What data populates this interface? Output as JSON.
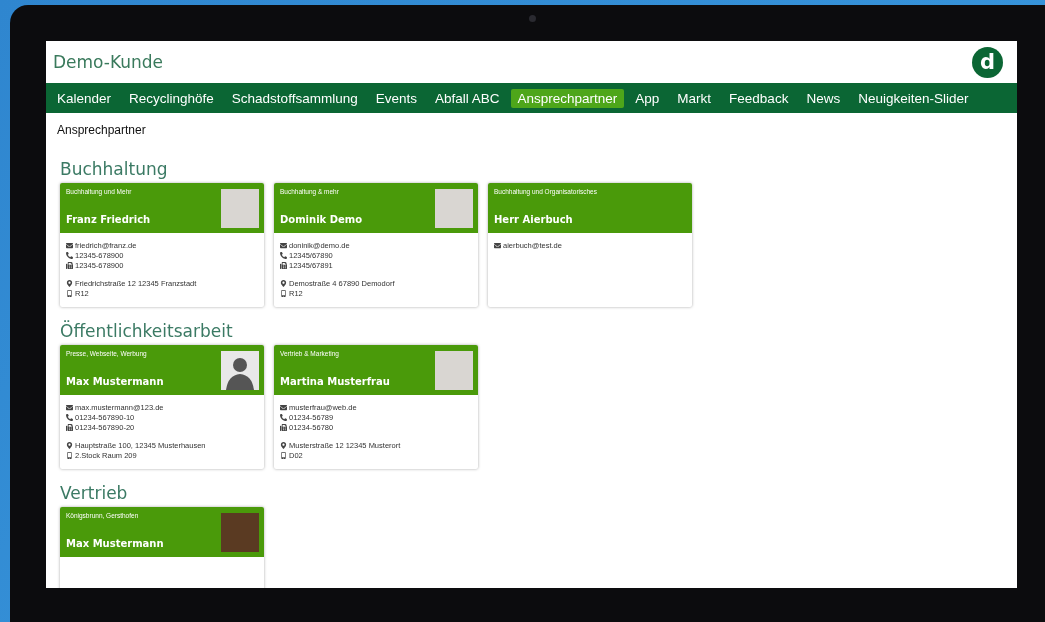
{
  "window": {
    "title": "Demo-Kunde",
    "logo": "d"
  },
  "nav": [
    {
      "label": "Kalender",
      "selected": false
    },
    {
      "label": "Recyclinghöfe",
      "selected": false
    },
    {
      "label": "Schadstoffsammlung",
      "selected": false
    },
    {
      "label": "Events",
      "selected": false
    },
    {
      "label": "Abfall ABC",
      "selected": false
    },
    {
      "label": "Ansprechpartner",
      "selected": true
    },
    {
      "label": "App",
      "selected": false
    },
    {
      "label": "Markt",
      "selected": false
    },
    {
      "label": "Feedback",
      "selected": false
    },
    {
      "label": "News",
      "selected": false
    },
    {
      "label": "Neuigkeiten-Slider",
      "selected": false
    }
  ],
  "page_title": "Ansprechpartner",
  "sections": [
    {
      "title": "Buchhaltung",
      "cards": [
        {
          "tagline": "Buchhaltung und Mehr",
          "name": "Franz Friedrich",
          "photo": {
            "kind": "portrait"
          },
          "contact": [
            {
              "kind": "email",
              "text": "friedrich@franz.de"
            },
            {
              "kind": "phone",
              "text": "12345-678900"
            },
            {
              "kind": "fax",
              "text": "12345-678900"
            }
          ],
          "location": [
            {
              "kind": "address",
              "text": "Friedrichstraße 12 12345 Franzstadt"
            },
            {
              "kind": "room",
              "text": "R12"
            }
          ]
        },
        {
          "tagline": "Buchhaltung & mehr",
          "name": "Dominik Demo",
          "photo": {
            "kind": "portrait"
          },
          "contact": [
            {
              "kind": "email",
              "text": "doninik@demo.de"
            },
            {
              "kind": "phone",
              "text": "12345/67890"
            },
            {
              "kind": "fax",
              "text": "12345/67891"
            }
          ],
          "location": [
            {
              "kind": "address",
              "text": "Demostraße 4 67890 Demodorf"
            },
            {
              "kind": "room",
              "text": "R12"
            }
          ]
        },
        {
          "tagline": "Buchhaltung und Organisatorisches",
          "name": "Herr Aierbuch",
          "contact": [
            {
              "kind": "email",
              "text": "aierbuch@test.de"
            }
          ]
        }
      ]
    },
    {
      "title": "Öffentlichkeitsarbeit",
      "cards": [
        {
          "tagline": "Presse, Webseite, Werbung",
          "name": "Max Mustermann",
          "photo": {
            "kind": "silhouette"
          },
          "contact": [
            {
              "kind": "email",
              "text": "max.mustermann@123.de"
            },
            {
              "kind": "phone",
              "text": "01234-567890-10"
            },
            {
              "kind": "fax",
              "text": "01234-567890-20"
            }
          ],
          "location": [
            {
              "kind": "address",
              "text": "Hauptstraße 100, 12345 Musterhausen"
            },
            {
              "kind": "room",
              "text": "2.Stock Raum 209"
            }
          ]
        },
        {
          "tagline": "Vertrieb & Marketing",
          "name": "Martina Musterfrau",
          "photo": {
            "kind": "portrait"
          },
          "contact": [
            {
              "kind": "email",
              "text": "musterfrau@web.de"
            },
            {
              "kind": "phone",
              "text": "01234-56789"
            },
            {
              "kind": "fax",
              "text": "01234-56780"
            }
          ],
          "location": [
            {
              "kind": "address",
              "text": "Musterstraße 12 12345 Musterort"
            },
            {
              "kind": "room",
              "text": "D02"
            }
          ]
        }
      ]
    },
    {
      "title": "Vertrieb",
      "cards": [
        {
          "tagline": "Königsbrunn, Gersthofen",
          "name": "Max Mustermann",
          "photo": {
            "kind": "crowd"
          }
        }
      ]
    }
  ]
}
